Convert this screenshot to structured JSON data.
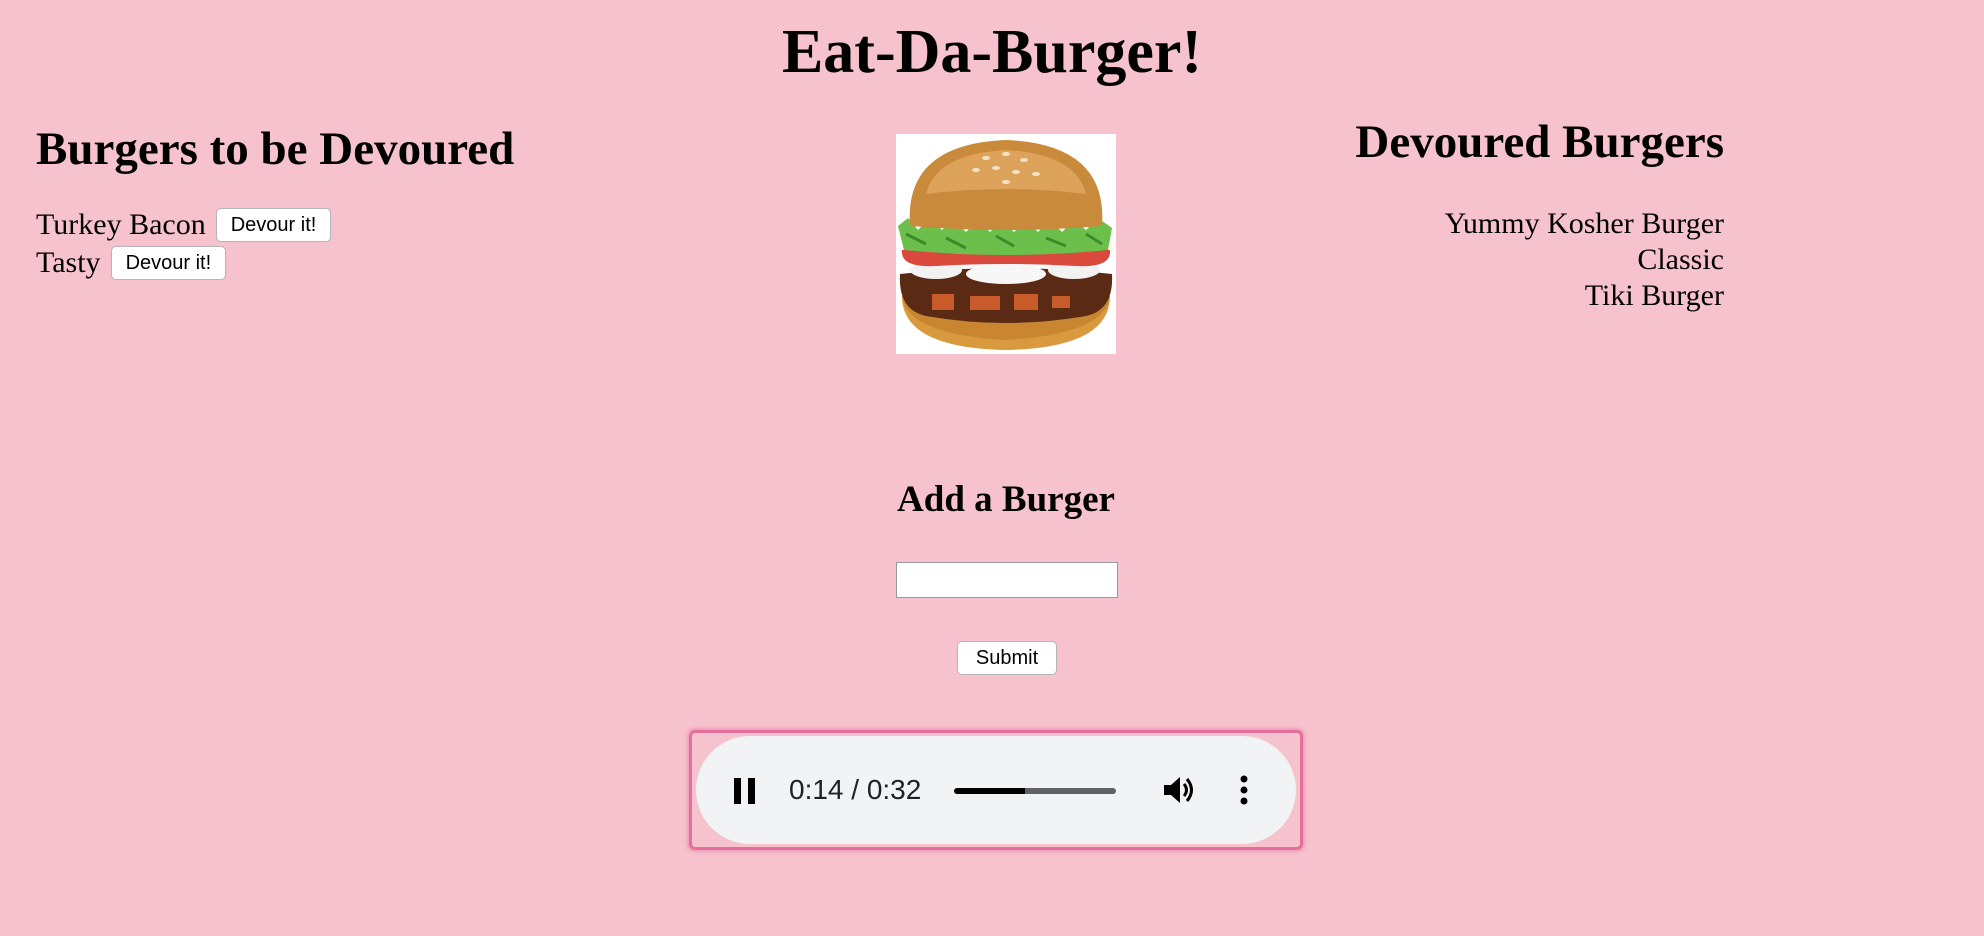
{
  "header": {
    "title": "Eat-Da-Burger!"
  },
  "to_devour": {
    "heading": "Burgers to be Devoured",
    "items": [
      {
        "name": "Turkey Bacon",
        "button_label": "Devour it!"
      },
      {
        "name": "Tasty",
        "button_label": "Devour it!"
      }
    ]
  },
  "burger_image": {
    "icon": "burger-illustration"
  },
  "devoured": {
    "heading": "Devoured Burgers",
    "items": [
      "Yummy Kosher Burger",
      "Classic",
      "Tiki Burger"
    ]
  },
  "add_form": {
    "heading": "Add a Burger",
    "input_value": "",
    "submit_label": "Submit"
  },
  "audio_player": {
    "state": "playing",
    "play_pause_icon": "pause-icon",
    "time_display": "0:14 / 0:32",
    "progress_fraction": 0.4375,
    "volume_icon": "volume-icon",
    "menu_icon": "more-vert-icon",
    "focus_outline_color": "#e5709d"
  },
  "colors": {
    "background": "#f6c2cd",
    "player_background": "#f1f3f4"
  }
}
